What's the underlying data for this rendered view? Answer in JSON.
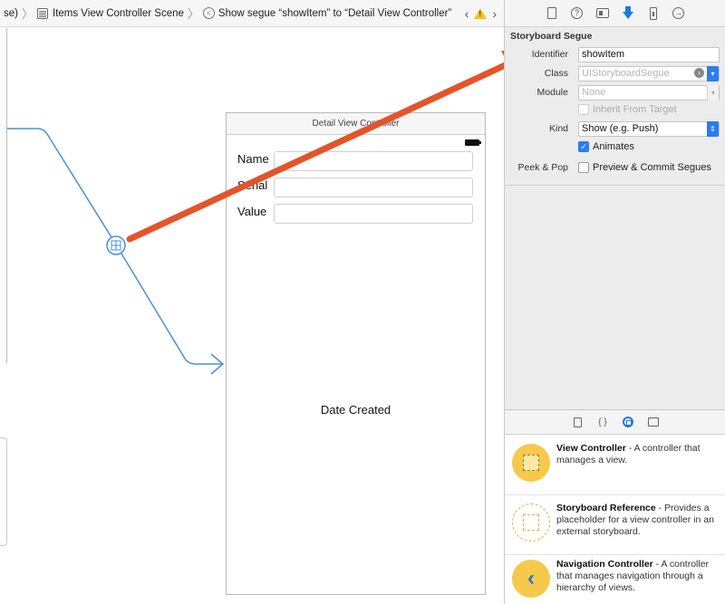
{
  "jumpbar": {
    "crumb_prev": "se)",
    "crumb_scene": "Items View Controller Scene",
    "crumb_segue": "Show segue “showItem” to “Detail View Controller”",
    "nav_prev": "‹",
    "nav_next": "›"
  },
  "canvas": {
    "detail_vc": {
      "title": "Detail View Controller",
      "fields": [
        {
          "label": "Name"
        },
        {
          "label": "Serial"
        },
        {
          "label": "Value"
        }
      ],
      "date_label": "Date Created"
    },
    "annotation_color": "#e4542a",
    "segue_color": "#4a8fd8"
  },
  "inspector": {
    "tabs": [
      "file-icon",
      "help-icon",
      "identity-icon",
      "attributes-icon",
      "size-icon",
      "connections-icon"
    ],
    "section_title": "Storyboard Segue",
    "identifier_label": "Identifier",
    "identifier_value": "showItem",
    "class_label": "Class",
    "class_placeholder": "UIStoryboardSegue",
    "module_label": "Module",
    "module_placeholder": "None",
    "inherit_label": "Inherit From Target",
    "kind_label": "Kind",
    "kind_value": "Show (e.g. Push)",
    "animates_label": "Animates",
    "peek_label": "Peek & Pop",
    "preview_label": "Preview & Commit Segues"
  },
  "library": {
    "tabs": [
      "file-template-icon",
      "code-snippet-icon",
      "object-library-icon",
      "media-library-icon"
    ],
    "items": [
      {
        "name": "View Controller",
        "desc": " - A controller that manages a view."
      },
      {
        "name": "Storyboard Reference",
        "desc": " - Provides a placeholder for a view controller in an external storyboard."
      },
      {
        "name": "Navigation Controller",
        "desc": " - A controller that manages navigation through a hierarchy of views."
      }
    ]
  }
}
